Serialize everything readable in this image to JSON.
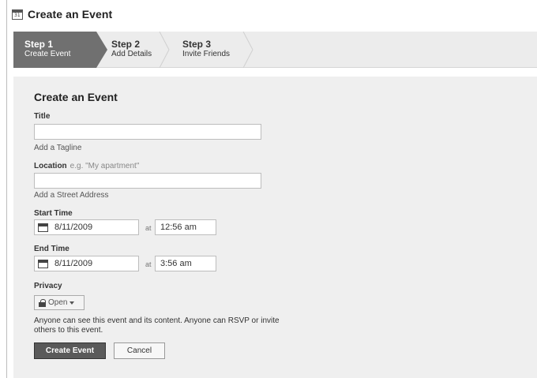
{
  "header": {
    "title": "Create an Event",
    "icon": "calendar-icon",
    "icon_text": "31"
  },
  "steps": [
    {
      "number": "Step 1",
      "label": "Create Event",
      "active": true
    },
    {
      "number": "Step 2",
      "label": "Add Details",
      "active": false
    },
    {
      "number": "Step 3",
      "label": "Invite Friends",
      "active": false
    }
  ],
  "form": {
    "title": "Create an Event",
    "title_field": {
      "label": "Title",
      "value": "",
      "placeholder": ""
    },
    "tagline_link": "Add a Tagline",
    "location_field": {
      "label": "Location",
      "hint": "e.g. \"My apartment\"",
      "value": ""
    },
    "street_link": "Add a Street Address",
    "start": {
      "label": "Start Time",
      "date": "8/11/2009",
      "at": "at",
      "time": "12:56 am"
    },
    "end": {
      "label": "End Time",
      "date": "8/11/2009",
      "at": "at",
      "time": "3:56 am"
    },
    "privacy": {
      "label": "Privacy",
      "selected": "Open",
      "description": "Anyone can see this event and its content. Anyone can RSVP or invite others to this event."
    },
    "submit_label": "Create Event",
    "cancel_label": "Cancel"
  },
  "colors": {
    "active_step": "#707070",
    "primary_button": "#5a5a5a",
    "panel_bg": "#efefef"
  }
}
